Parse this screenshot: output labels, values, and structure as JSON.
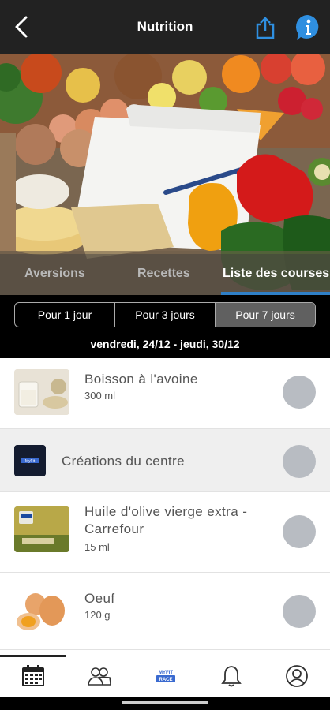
{
  "header": {
    "title": "Nutrition",
    "back_icon": "back-chevron-icon",
    "share_icon": "share-icon",
    "info_icon": "info-icon",
    "accent": "#2f8fe0"
  },
  "tabs": [
    {
      "label": "Aversions",
      "active": false
    },
    {
      "label": "Recettes",
      "active": false
    },
    {
      "label": "Liste des courses",
      "active": true
    }
  ],
  "period": {
    "options": [
      {
        "label": "Pour 1 jour",
        "active": false
      },
      {
        "label": "Pour 3 jours",
        "active": false
      },
      {
        "label": "Pour 7 jours",
        "active": true
      }
    ],
    "date_range": "vendredi, 24/12 - jeudi, 30/12"
  },
  "items": [
    {
      "name": "Boisson à l'avoine",
      "qty": "300 ml",
      "type": "item"
    },
    {
      "name": "Créations du centre",
      "qty": "",
      "type": "group"
    },
    {
      "name": "Huile d'olive vierge extra - Carrefour",
      "qty": "15 ml",
      "type": "item"
    },
    {
      "name": "Oeuf",
      "qty": "120 g",
      "type": "item"
    }
  ],
  "logo_text": "MyFit",
  "bottom_nav": [
    {
      "icon": "calendar-icon",
      "active": true
    },
    {
      "icon": "group-icon",
      "active": false
    },
    {
      "icon": "brand-logo-icon",
      "active": false,
      "label": "MYFIT RACE"
    },
    {
      "icon": "bell-icon",
      "active": false
    },
    {
      "icon": "profile-icon",
      "active": false
    }
  ],
  "colors": {
    "tab_indicator": "#2f7fc6",
    "check_circle": "#b8bcc2",
    "header_bg": "#222222"
  }
}
